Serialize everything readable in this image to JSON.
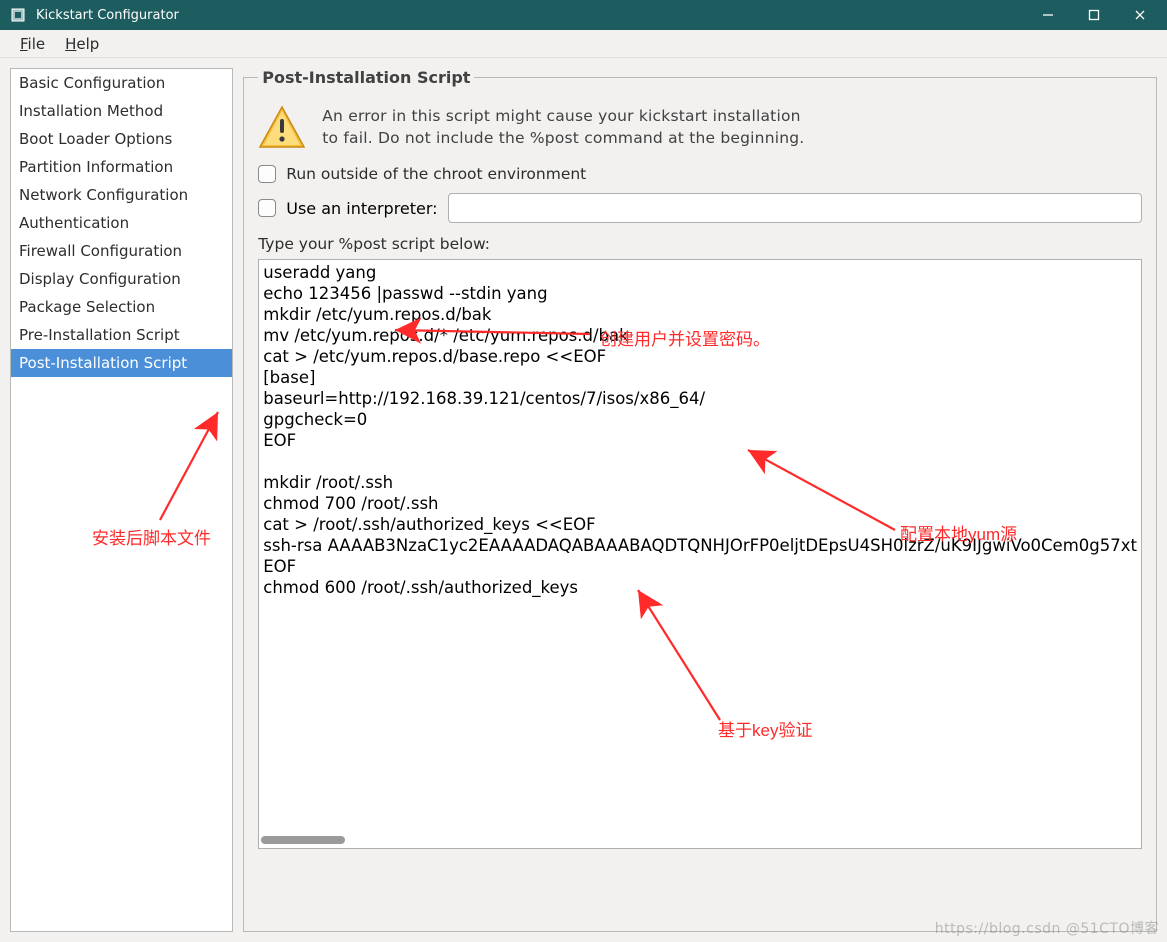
{
  "window": {
    "title": "Kickstart Configurator"
  },
  "menubar": {
    "file": "File",
    "help": "Help"
  },
  "sidebar": {
    "items": [
      {
        "label": "Basic Configuration"
      },
      {
        "label": "Installation Method"
      },
      {
        "label": "Boot Loader Options"
      },
      {
        "label": "Partition Information"
      },
      {
        "label": "Network Configuration"
      },
      {
        "label": "Authentication"
      },
      {
        "label": "Firewall Configuration"
      },
      {
        "label": "Display Configuration"
      },
      {
        "label": "Package Selection"
      },
      {
        "label": "Pre-Installation Script"
      },
      {
        "label": "Post-Installation Script"
      }
    ],
    "selected_index": 10
  },
  "panel": {
    "legend": "Post-Installation Script",
    "warning": "An error in this script might cause your kickstart installation\nto fail. Do not include the %post command at the beginning.",
    "chroot_label": "Run outside of the chroot environment",
    "interp_label": "Use an interpreter:",
    "interp_value": "",
    "below_label": "Type your %post script below:",
    "script": "useradd yang\necho 123456 |passwd --stdin yang\nmkdir /etc/yum.repos.d/bak\nmv /etc/yum.repos.d/* /etc/yum.repos.d/bak\ncat > /etc/yum.repos.d/base.repo <<EOF\n[base]\nbaseurl=http://192.168.39.121/centos/7/isos/x86_64/\ngpgcheck=0\nEOF\n\nmkdir /root/.ssh\nchmod 700 /root/.ssh\ncat > /root/.ssh/authorized_keys <<EOF\nssh-rsa AAAAB3NzaC1yc2EAAAADAQABAAABAQDTQNHJOrFP0eljtDEpsU4SH0lzrZ/uK9IJgwiVo0Cem0g57xt\nEOF\nchmod 600 /root/.ssh/authorized_keys"
  },
  "annotations": {
    "a1": "创建用户并设置密码。",
    "a2": "配置本地yum源",
    "a3": "基于key验证",
    "a4": "安装后脚本文件"
  },
  "watermark": "https://blog.csdn @51CTO博客"
}
